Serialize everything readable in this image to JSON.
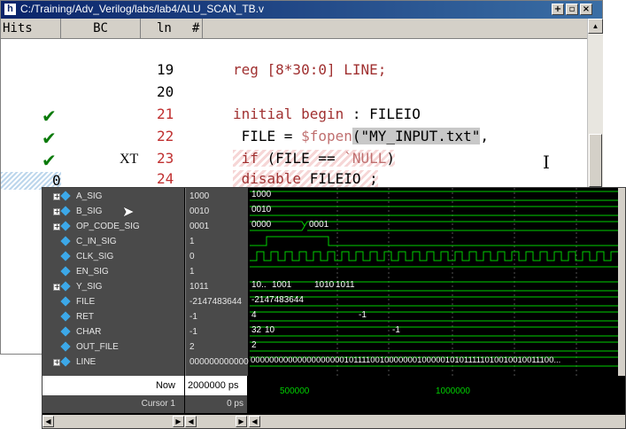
{
  "window": {
    "title": "C:/Training/Adv_Verilog/labs/lab4/ALU_SCAN_TB.v",
    "app_icon": "h"
  },
  "columns": {
    "hits": "Hits",
    "bc": "BC",
    "ln": "ln",
    "hash": "#"
  },
  "code_lines": [
    {
      "ln": "19",
      "text_kw": "reg [8*30:0] LINE;",
      "hits": "",
      "bc": ""
    },
    {
      "ln": "20",
      "text_kw": "",
      "hits": "",
      "bc": ""
    },
    {
      "ln": "21",
      "kw": "initial begin",
      "rest": " : FILEIO",
      "hits": "check",
      "bc": ""
    },
    {
      "ln": "22",
      "pre": " FILE = ",
      "sys": "$fopen",
      "paren": "(",
      "str": "\"MY_INPUT.txt\"",
      "post": ",",
      "hits": "check",
      "bc": ""
    },
    {
      "ln": "23",
      "kw": " if",
      "rest": " (FILE == ",
      "sys": "`NULL",
      "post": ")",
      "hits": "check",
      "bc": "XT"
    },
    {
      "ln": "24",
      "kw": " disable",
      "rest": " FILEIO ;",
      "hits": "0",
      "bc": ""
    }
  ],
  "signals": [
    {
      "name": "A_SIG",
      "value": "1000",
      "expand": true
    },
    {
      "name": "B_SIG",
      "value": "0010",
      "expand": true
    },
    {
      "name": "OP_CODE_SIG",
      "value": "0001",
      "expand": true
    },
    {
      "name": "C_IN_SIG",
      "value": "1",
      "expand": false
    },
    {
      "name": "CLK_SIG",
      "value": "0",
      "expand": false
    },
    {
      "name": "EN_SIG",
      "value": "1",
      "expand": false
    },
    {
      "name": "Y_SIG",
      "value": "1011",
      "expand": true
    },
    {
      "name": "FILE",
      "value": "-2147483644",
      "expand": false
    },
    {
      "name": "RET",
      "value": "-1",
      "expand": false
    },
    {
      "name": "CHAR",
      "value": "-1",
      "expand": false
    },
    {
      "name": "OUT_FILE",
      "value": "2",
      "expand": false
    },
    {
      "name": "LINE",
      "value": "000000000000",
      "expand": true
    }
  ],
  "wave_labels": {
    "a": "1000",
    "b": "0010",
    "op1": "0000",
    "op2": "0001",
    "y1": "10..",
    "y2": "1001",
    "y3": "1010",
    "y4": "1011",
    "file": "-2147483644",
    "ret1": "4",
    "ret2": "-1",
    "char1": "32",
    "char2": "10",
    "char3": "-1",
    "outfile": "2",
    "line": "000000000000000000001011110010000000100000101011111010010010011100..."
  },
  "footer": {
    "now_label": "Now",
    "now_value": "2000000 ps",
    "cursor_label": "Cursor 1",
    "cursor_value": "0 ps",
    "tick1": "500000",
    "tick2": "1000000"
  },
  "colors": {
    "accent_title": "#0a246a",
    "wave_green": "#00d000",
    "keyword": "#a03030"
  }
}
